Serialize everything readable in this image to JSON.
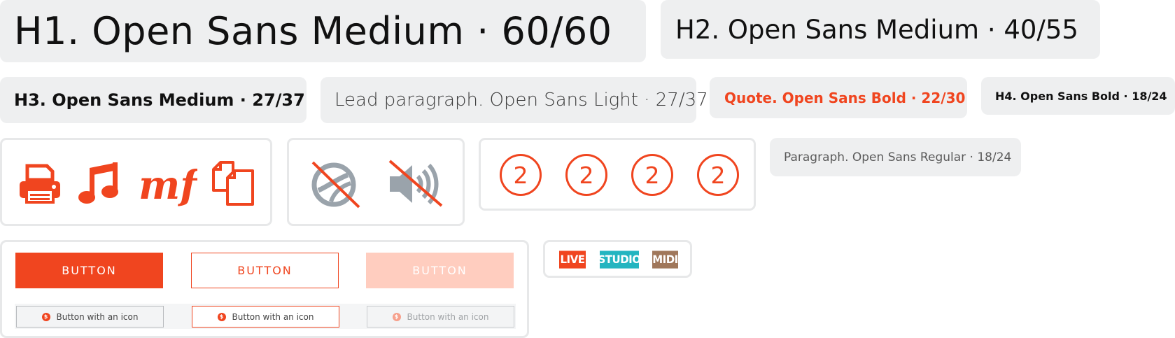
{
  "typography": {
    "h1": "H1. Open Sans Medium · 60/60",
    "h2": "H2. Open Sans Medium · 40/55",
    "h3": "H3. Open Sans Medium · 27/37",
    "lead": "Lead paragraph. Open Sans Light · 27/37",
    "quote": "Quote. Open Sans Bold · 22/30",
    "h4": "H4. Open Sans Bold · 18/24",
    "paragraph": "Paragraph. Open Sans Regular · 18/24"
  },
  "icons": [
    "printer-icon",
    "music-note-icon",
    "mf-dynamic-icon",
    "copy-icon"
  ],
  "disabled_icons": [
    "no-globe-icon",
    "muted-speaker-icon"
  ],
  "badges": [
    "2",
    "2",
    "2",
    "2"
  ],
  "buttons": {
    "primary": "BUTTON",
    "secondary": "BUTTON",
    "disabled": "BUTTON"
  },
  "icon_buttons": {
    "icon_glyph": "$",
    "default": "Button with an icon",
    "outline": "Button with an icon",
    "disabled": "Button with an icon"
  },
  "tags": [
    {
      "label": "LIVE",
      "color": "#f0451f"
    },
    {
      "label": "STUDIO",
      "color": "#23b5c0"
    },
    {
      "label": "MIDI",
      "color": "#a0775a"
    }
  ],
  "colors": {
    "accent": "#f0451f",
    "accent_light": "#ffcdbf",
    "chip_bg": "#eeeff0",
    "icon_grey": "#9aa3ab"
  }
}
